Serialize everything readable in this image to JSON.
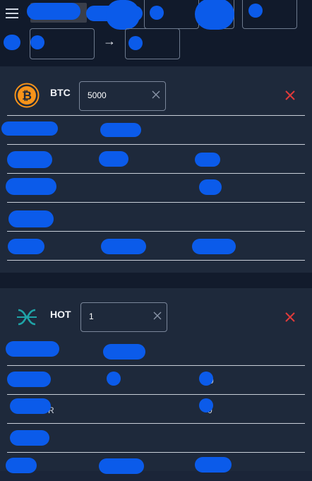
{
  "colors": {
    "background": "#1b2538",
    "topbar": "#111a2b",
    "card": "#1e293b",
    "redaction": "#0b5bea",
    "remove": "#e03a3a",
    "btc": "#f7931a",
    "hot": "#1fa4a8"
  },
  "header": {
    "menu_icon": "hamburger-icon",
    "convert_arrow": "→"
  },
  "coins": [
    {
      "symbol": "BTC",
      "icon": "bitcoin-icon",
      "amount": "5000",
      "clear_icon": "clear-x-icon",
      "remove_icon": "remove-x-icon"
    },
    {
      "symbol": "HOT",
      "icon": "holo-icon",
      "amount": "1",
      "clear_icon": "clear-x-icon",
      "remove_icon": "remove-x-icon",
      "partial_texts": [
        "R",
        "0",
        "0"
      ]
    }
  ]
}
